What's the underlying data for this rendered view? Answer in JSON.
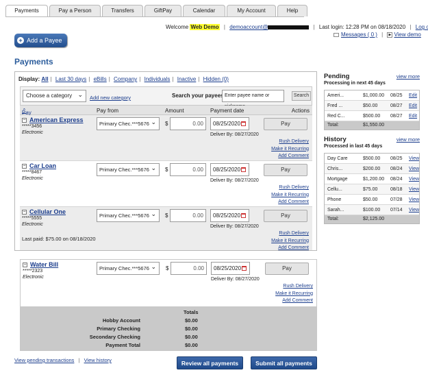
{
  "tabs": [
    "Payments",
    "Pay a Person",
    "Transfers",
    "GiftPay",
    "Calendar",
    "My Account",
    "Help"
  ],
  "header": {
    "welcome_prefix": "Welcome",
    "user_name": "Web Demo",
    "email": "demoaccount@",
    "last_login": "Last login: 12:28 PM on 08/18/2020",
    "logout": "Log out",
    "messages": "Messages ( 0 )",
    "view_demo": "View demo"
  },
  "add_payee_label": "Add a Payee",
  "page_title": "Payments",
  "display_filter": {
    "label": "Display:",
    "options": [
      "All",
      "Last 30 days",
      "eBills",
      "Company",
      "Individuals",
      "Inactive",
      "Hidden (0)"
    ]
  },
  "filter": {
    "category_select": "Choose a category",
    "add_category": "Add new category",
    "search_label": "Search your payees",
    "search_placeholder": "Enter payee name or nickname",
    "search_button": "Search"
  },
  "columns": {
    "pay_to": "Pay To",
    "pay_from": "Pay from",
    "amount": "Amount",
    "payment_date": "Payment date",
    "actions": "Actions"
  },
  "payees": [
    {
      "name": "American Express",
      "account": "*****3456",
      "type": "Electronic",
      "pay_from": "Primary Chec.***5676",
      "amount": "0.00",
      "date": "08/25/2020",
      "deliver": "Deliver By: 08/27/2020",
      "last_paid": ""
    },
    {
      "name": "Car Loan",
      "account": "*****8467",
      "type": "Electronic",
      "pay_from": "Primary Chec.***5676",
      "amount": "0.00",
      "date": "08/25/2020",
      "deliver": "Deliver By: 08/27/2020",
      "last_paid": ""
    },
    {
      "name": "Cellular One",
      "account": "*****5555",
      "type": "Electronic",
      "pay_from": "Primary Chec.***5676",
      "amount": "0.00",
      "date": "08/25/2020",
      "deliver": "Deliver By: 08/27/2020",
      "last_paid": "Last paid: $75.00 on 08/18/2020"
    },
    {
      "name": "Water Bill",
      "account": "*****2323",
      "type": "Electronic",
      "pay_from": "Primary Chec.***5676",
      "amount": "0.00",
      "date": "08/25/2020",
      "deliver": "Deliver By: 08/27/2020",
      "last_paid": ""
    }
  ],
  "row_actions": {
    "pay": "Pay",
    "rush": "Rush Delivery",
    "recurring": "Make it Recurring",
    "comment": "Add Comment"
  },
  "currency_symbol": "$",
  "totals": {
    "header": "Totals",
    "rows": [
      {
        "label": "Hobby Account",
        "value": "$0.00"
      },
      {
        "label": "Primary Checking",
        "value": "$0.00"
      },
      {
        "label": "Secondary Checking",
        "value": "$0.00"
      },
      {
        "label": "Payment Total",
        "value": "$0.00"
      }
    ]
  },
  "bottom": {
    "pending_link": "View pending transactions",
    "history_link": "View history",
    "review_button": "Review all payments",
    "submit_button": "Submit all payments"
  },
  "pending": {
    "title": "Pending",
    "subtitle": "Processing in next 45 days",
    "view_more": "view more",
    "action": "Edit",
    "rows": [
      {
        "name": "Ameri...",
        "amount": "$1,000.00",
        "date": "08/25"
      },
      {
        "name": "Fred ...",
        "amount": "$50.00",
        "date": "08/27"
      },
      {
        "name": "Red C...",
        "amount": "$500.00",
        "date": "08/27"
      }
    ],
    "total_label": "Total:",
    "total_value": "$1,550.00"
  },
  "history": {
    "title": "History",
    "subtitle": "Processed in last 45 days",
    "view_more": "view more",
    "action": "View",
    "rows": [
      {
        "name": "Day Care",
        "amount": "$500.00",
        "date": "08/25"
      },
      {
        "name": "Chris...",
        "amount": "$200.00",
        "date": "08/24"
      },
      {
        "name": "Mortgage",
        "amount": "$1,200.00",
        "date": "08/24"
      },
      {
        "name": "Cellu...",
        "amount": "$75.00",
        "date": "08/18"
      },
      {
        "name": "Phone",
        "amount": "$50.00",
        "date": "07/28"
      },
      {
        "name": "Sarah...",
        "amount": "$100.00",
        "date": "07/14"
      }
    ],
    "total_label": "Total:",
    "total_value": "$2,125.00"
  },
  "colors": {
    "accent": "#2c5d9c",
    "button_blue": "#1f4a8a",
    "highlight": "#ffff33"
  }
}
